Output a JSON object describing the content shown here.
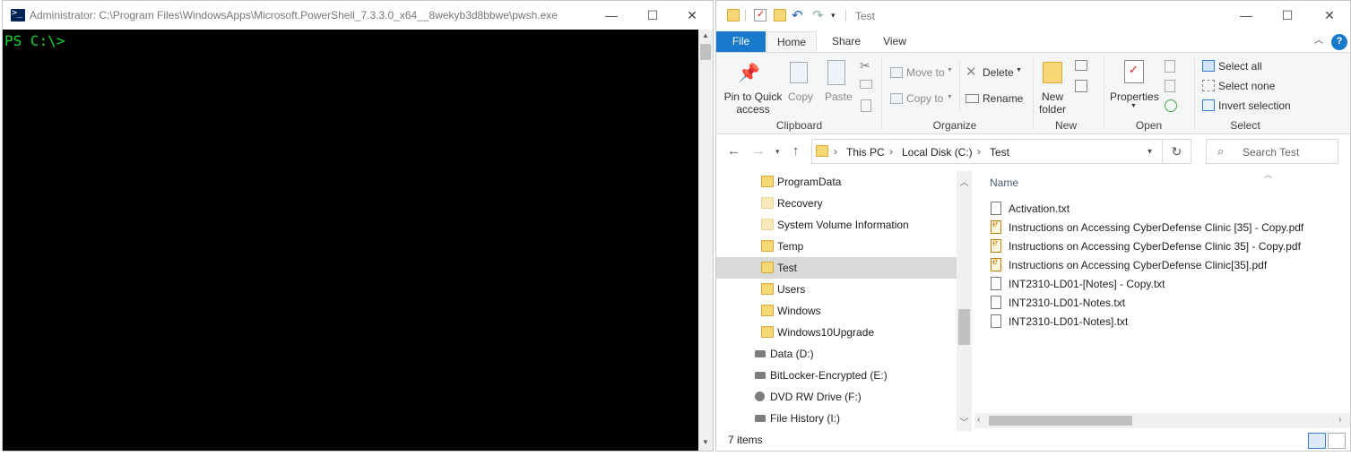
{
  "powershell": {
    "title": "Administrator: C:\\Program Files\\WindowsApps\\Microsoft.PowerShell_7.3.3.0_x64__8wekyb3d8bbwe\\pwsh.exe",
    "prompt": "PS C:\\>",
    "controls": {
      "minimize": "—",
      "maximize": "☐",
      "close": "✕"
    },
    "colors": {
      "console_bg": "#000000",
      "prompt_fg": "#13d630"
    }
  },
  "explorer": {
    "title": "Test",
    "controls": {
      "minimize": "—",
      "maximize": "☐",
      "close": "✕"
    },
    "tabs": [
      "File",
      "Home",
      "Share",
      "View"
    ],
    "ribbon": {
      "clipboard": {
        "label": "Clipboard",
        "pin_line1": "Pin to Quick",
        "pin_line2": "access",
        "copy": "Copy",
        "paste": "Paste"
      },
      "organize": {
        "label": "Organize",
        "move_to": "Move to",
        "copy_to": "Copy to",
        "delete": "Delete",
        "rename": "Rename"
      },
      "new": {
        "label": "New",
        "new_folder_line1": "New",
        "new_folder_line2": "folder"
      },
      "open": {
        "label": "Open",
        "properties": "Properties"
      },
      "select": {
        "label": "Select",
        "select_all": "Select all",
        "select_none": "Select none",
        "invert": "Invert selection"
      }
    },
    "address": {
      "crumbs": [
        "This PC",
        "Local Disk (C:)",
        "Test"
      ],
      "search_placeholder": "Search Test"
    },
    "nav_pane": {
      "folders": [
        "ProgramData",
        "Recovery",
        "System Volume Information",
        "Temp",
        "Test",
        "Users",
        "Windows",
        "Windows10Upgrade"
      ],
      "selected": "Test",
      "drives": [
        "Data (D:)",
        "BitLocker-Encrypted (E:)",
        "DVD RW Drive (F:)",
        "File History (I:)"
      ]
    },
    "file_pane": {
      "column_name": "Name",
      "files": [
        {
          "name": "Activation.txt",
          "type": "txt"
        },
        {
          "name": "Instructions on Accessing CyberDefense Clinic [35] - Copy.pdf",
          "type": "pdf"
        },
        {
          "name": "Instructions on Accessing CyberDefense Clinic 35] - Copy.pdf",
          "type": "pdf"
        },
        {
          "name": "Instructions on Accessing CyberDefense Clinic[35].pdf",
          "type": "pdf"
        },
        {
          "name": "INT2310-LD01-[Notes] - Copy.txt",
          "type": "txt"
        },
        {
          "name": "INT2310-LD01-Notes.txt",
          "type": "txt"
        },
        {
          "name": "INT2310-LD01-Notes].txt",
          "type": "txt"
        }
      ]
    },
    "status": "7 items",
    "colors": {
      "file_tab": "#1979ca",
      "selected_row": "#d9d9d9",
      "folder": "#f8d775"
    }
  }
}
